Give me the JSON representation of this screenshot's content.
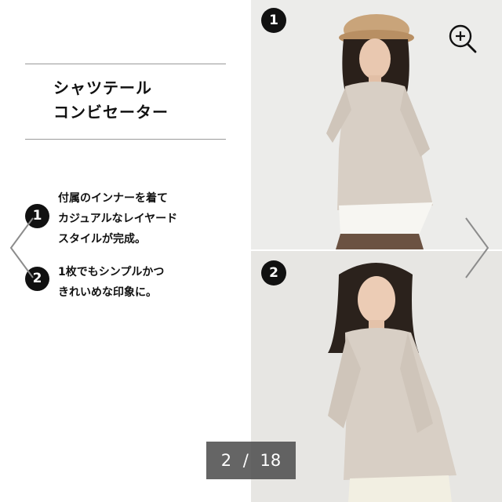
{
  "product": {
    "title_line1": "シャツテール",
    "title_line2": "コンビセーター"
  },
  "points": [
    {
      "badge": "1",
      "lines": [
        "付属のインナーを着て",
        "カジュアルなレイヤード",
        "スタイルが完成。"
      ]
    },
    {
      "badge": "2",
      "lines": [
        "1枚でもシンプルかつ",
        "きれいめな印象に。"
      ]
    }
  ],
  "photos": [
    {
      "badge": "1",
      "icon": "model-photo-layered"
    },
    {
      "badge": "2",
      "icon": "model-photo-single"
    }
  ],
  "zoom": {
    "icon": "zoom-in-icon"
  },
  "navigation": {
    "prev_icon": "chevron-left-icon",
    "next_icon": "chevron-right-icon"
  },
  "counter": {
    "current": "2",
    "separator": "/",
    "total": "18"
  },
  "colors": {
    "sweater": "#d8cfc5",
    "background": "#ececea",
    "counter_bg": "#505050"
  }
}
